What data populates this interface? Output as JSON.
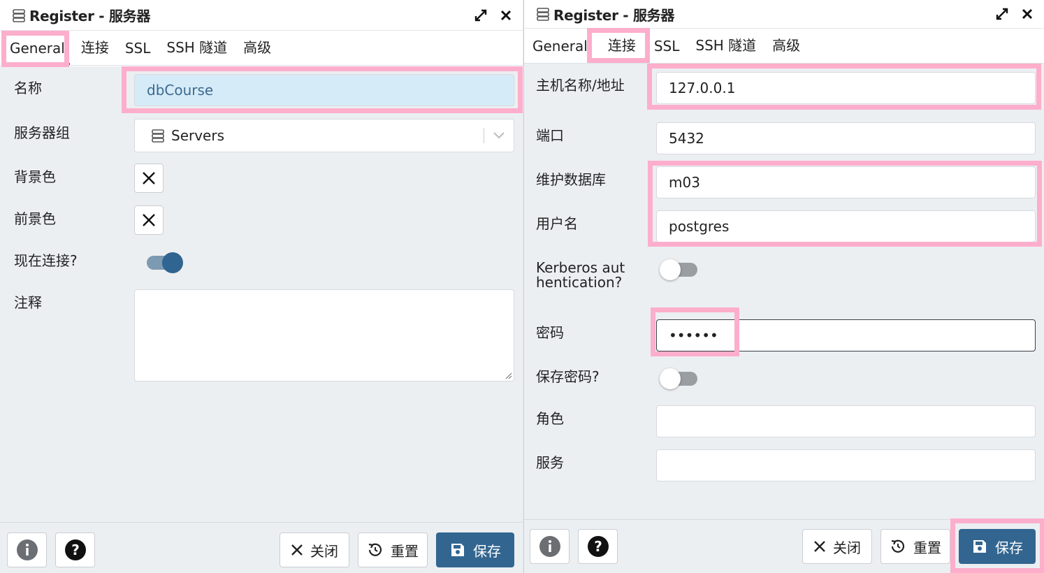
{
  "left": {
    "title": "Register - 服务器",
    "tabs": [
      "General",
      "连接",
      "SSL",
      "SSH 隧道",
      "高级"
    ],
    "fields": {
      "name_label": "名称",
      "name_value": "dbCourse",
      "group_label": "服务器组",
      "group_value": "Servers",
      "bgcolor_label": "背景色",
      "fgcolor_label": "前景色",
      "connect_label": "现在连接?",
      "comment_label": "注释"
    },
    "footer": {
      "close": "关闭",
      "reset": "重置",
      "save": "保存"
    }
  },
  "right": {
    "title": "Register - 服务器",
    "tabs": [
      "General",
      "连接",
      "SSL",
      "SSH 隧道",
      "高级"
    ],
    "fields": {
      "host_label": "主机名称/地址",
      "host_value": "127.0.0.1",
      "port_label": "端口",
      "port_value": "5432",
      "maintdb_label": "维护数据库",
      "maintdb_value": "m03",
      "user_label": "用户名",
      "user_value": "postgres",
      "kerberos_label": "Kerberos authentication?",
      "password_label": "密码",
      "password_value": "••••••",
      "savepw_label": "保存密码?",
      "role_label": "角色",
      "service_label": "服务"
    },
    "footer": {
      "close": "关闭",
      "reset": "重置",
      "save": "保存"
    }
  },
  "toggles": {
    "connect_now": true,
    "kerberos": false,
    "save_password": false
  },
  "colors": {
    "accent": "#326690",
    "highlight": "#fcaecb",
    "focused_input": "#d6ebf8",
    "panel_bg": "#eceff2"
  },
  "icons": [
    "server-icon",
    "expand-icon",
    "close-icon",
    "chevron-down-icon",
    "clear-color-icon",
    "info-icon",
    "help-icon",
    "reset-icon",
    "save-icon",
    "resize-grip-icon"
  ]
}
